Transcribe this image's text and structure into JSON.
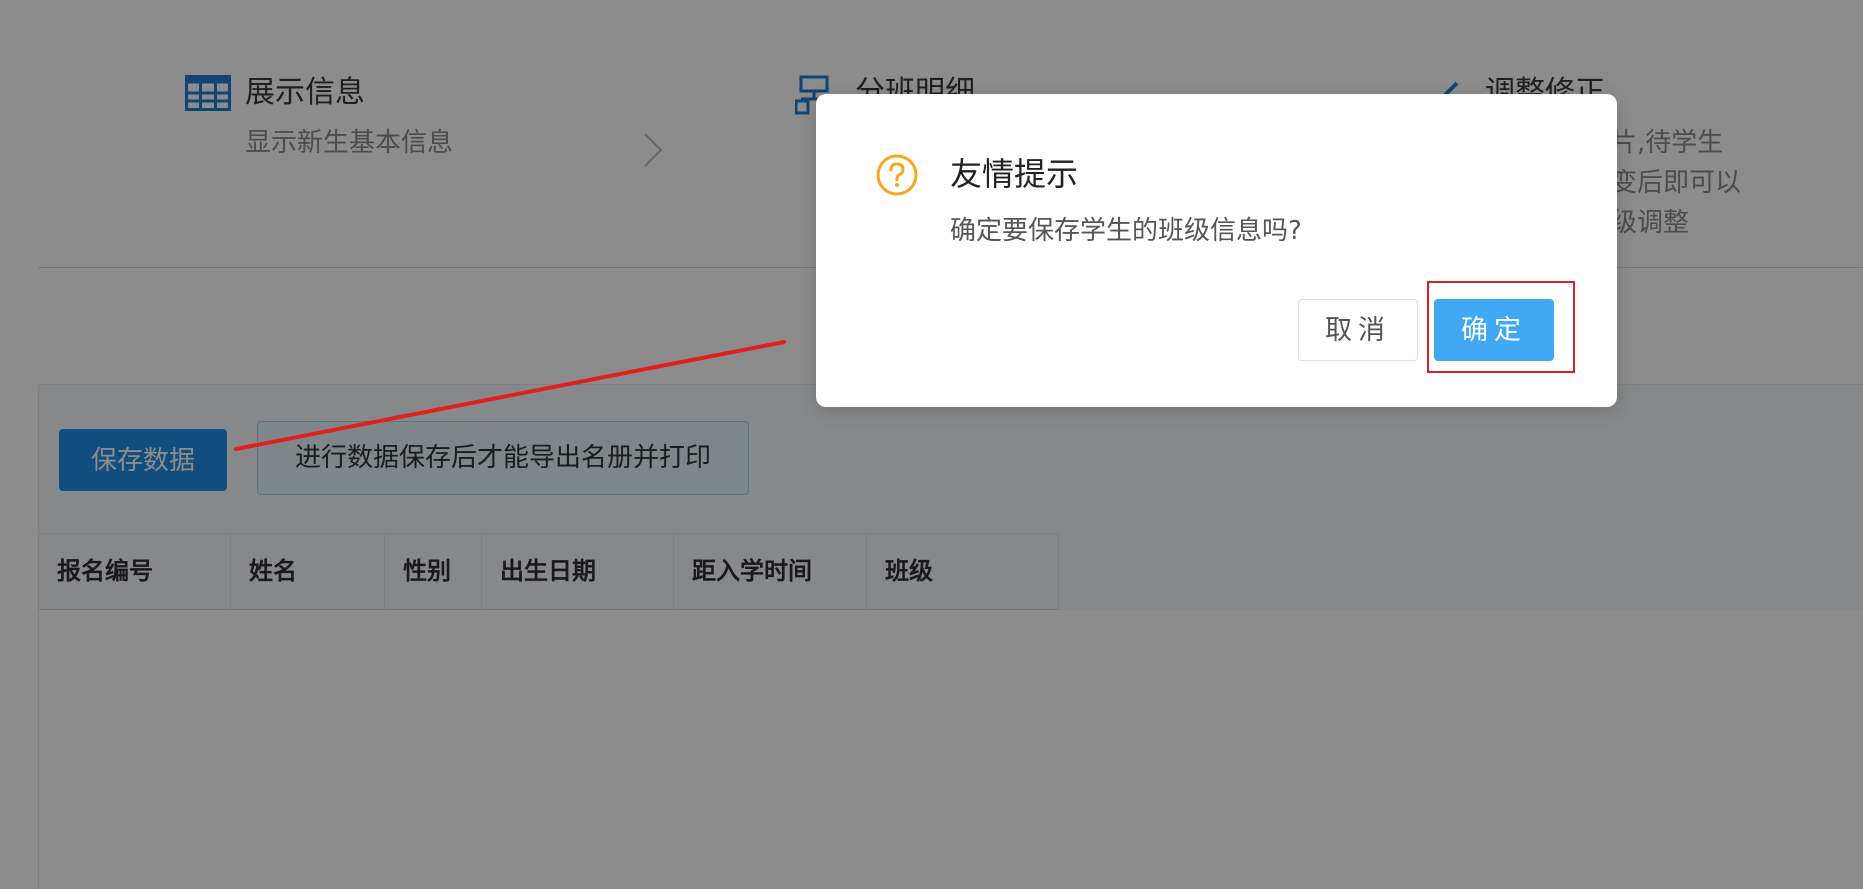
{
  "steps": [
    {
      "title": "展示信息",
      "description": "显示新生基本信息",
      "icon": "table-icon"
    },
    {
      "title": "分班明细",
      "icon": "structure-icon"
    },
    {
      "title": "调整修正",
      "description_lines": [
        "片,待学生",
        "变后即可以",
        "级调整"
      ],
      "icon": "pencil-icon"
    }
  ],
  "toolbar": {
    "save_label": "保存数据",
    "notice": "进行数据保存后才能导出名册并打印"
  },
  "table": {
    "columns": [
      "报名编号",
      "姓名",
      "性别",
      "出生日期",
      "距入学时间",
      "班级"
    ],
    "rows": []
  },
  "dialog": {
    "title": "友情提示",
    "message": "确定要保存学生的班级信息吗?",
    "cancel_label": "取消",
    "confirm_label": "确定",
    "icon": "question-circle-icon"
  },
  "colors": {
    "accent": "#1f8ce8",
    "confirm": "#3fa9f5",
    "warning_icon": "#f5a623",
    "annotation": "#e02020"
  }
}
